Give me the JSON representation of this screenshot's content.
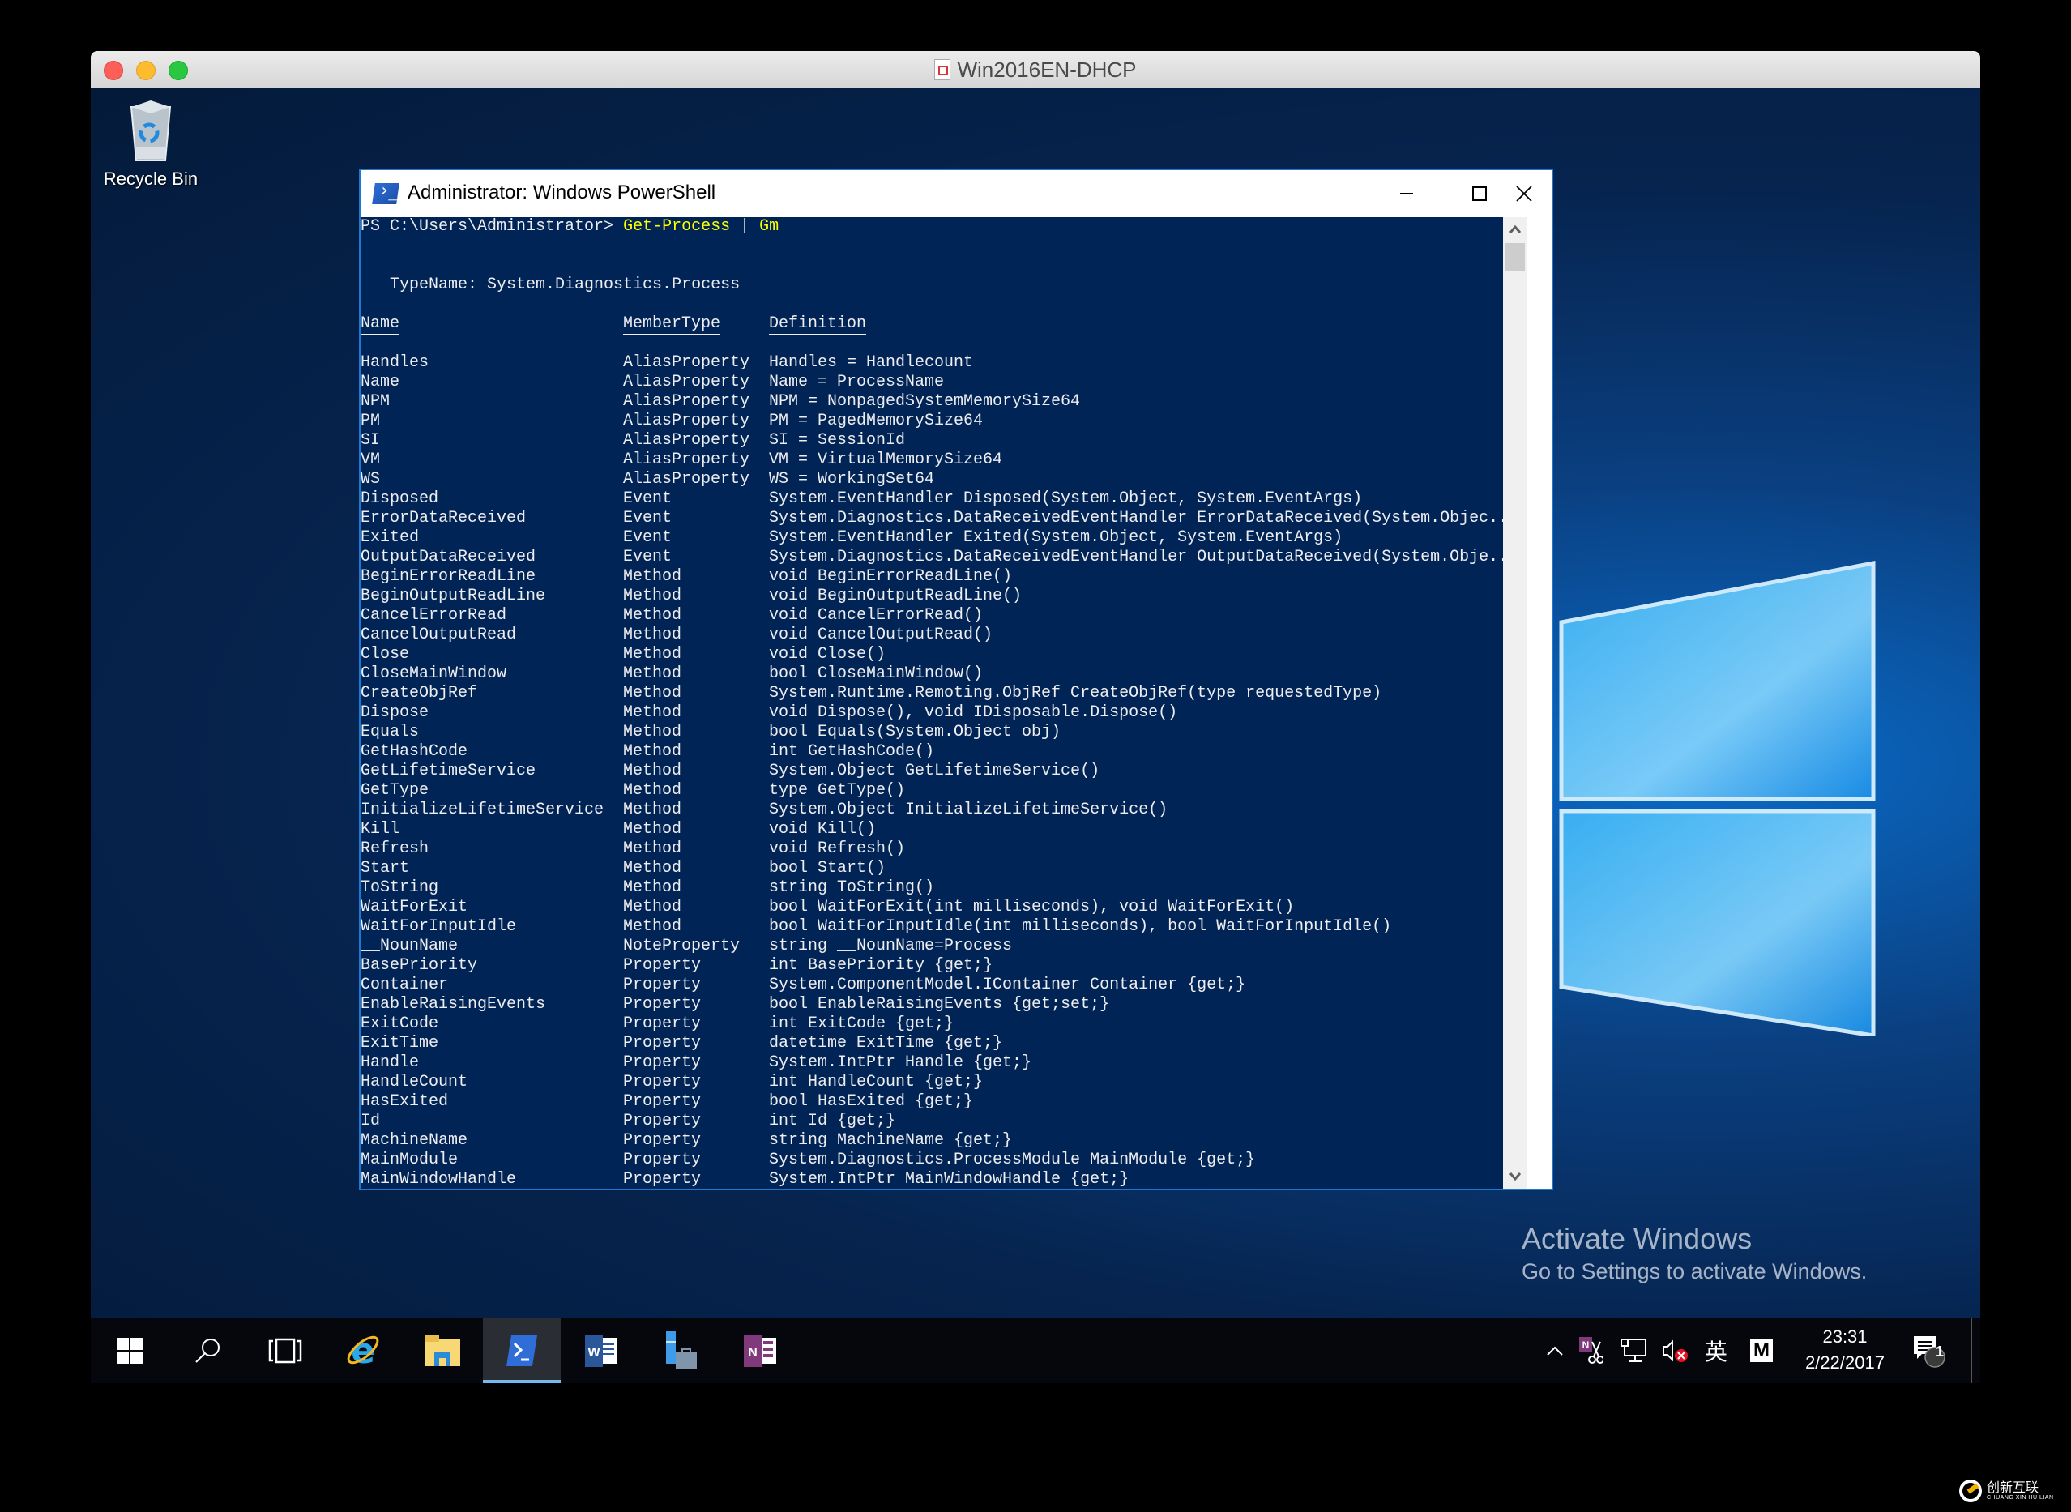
{
  "mac_window": {
    "title": "Win2016EN-DHCP"
  },
  "desktop": {
    "recycle_bin_label": "Recycle Bin",
    "activate_title": "Activate Windows",
    "activate_subtitle": "Go to Settings to activate Windows."
  },
  "powershell": {
    "title": "Administrator: Windows PowerShell",
    "prompt": "PS C:\\Users\\Administrator> ",
    "command_part1": "Get-Process",
    "pipe": " | ",
    "command_part2": "Gm",
    "typename_line": "   TypeName: System.Diagnostics.Process",
    "headers": {
      "name": "Name",
      "member_type": "MemberType",
      "definition": "Definition"
    },
    "rows": [
      {
        "name": "Handles",
        "type": "AliasProperty",
        "def": "Handles = Handlecount"
      },
      {
        "name": "Name",
        "type": "AliasProperty",
        "def": "Name = ProcessName"
      },
      {
        "name": "NPM",
        "type": "AliasProperty",
        "def": "NPM = NonpagedSystemMemorySize64"
      },
      {
        "name": "PM",
        "type": "AliasProperty",
        "def": "PM = PagedMemorySize64"
      },
      {
        "name": "SI",
        "type": "AliasProperty",
        "def": "SI = SessionId"
      },
      {
        "name": "VM",
        "type": "AliasProperty",
        "def": "VM = VirtualMemorySize64"
      },
      {
        "name": "WS",
        "type": "AliasProperty",
        "def": "WS = WorkingSet64"
      },
      {
        "name": "Disposed",
        "type": "Event",
        "def": "System.EventHandler Disposed(System.Object, System.EventArgs)"
      },
      {
        "name": "ErrorDataReceived",
        "type": "Event",
        "def": "System.Diagnostics.DataReceivedEventHandler ErrorDataReceived(System.Objec..."
      },
      {
        "name": "Exited",
        "type": "Event",
        "def": "System.EventHandler Exited(System.Object, System.EventArgs)"
      },
      {
        "name": "OutputDataReceived",
        "type": "Event",
        "def": "System.Diagnostics.DataReceivedEventHandler OutputDataReceived(System.Obje..."
      },
      {
        "name": "BeginErrorReadLine",
        "type": "Method",
        "def": "void BeginErrorReadLine()"
      },
      {
        "name": "BeginOutputReadLine",
        "type": "Method",
        "def": "void BeginOutputReadLine()"
      },
      {
        "name": "CancelErrorRead",
        "type": "Method",
        "def": "void CancelErrorRead()"
      },
      {
        "name": "CancelOutputRead",
        "type": "Method",
        "def": "void CancelOutputRead()"
      },
      {
        "name": "Close",
        "type": "Method",
        "def": "void Close()"
      },
      {
        "name": "CloseMainWindow",
        "type": "Method",
        "def": "bool CloseMainWindow()"
      },
      {
        "name": "CreateObjRef",
        "type": "Method",
        "def": "System.Runtime.Remoting.ObjRef CreateObjRef(type requestedType)"
      },
      {
        "name": "Dispose",
        "type": "Method",
        "def": "void Dispose(), void IDisposable.Dispose()"
      },
      {
        "name": "Equals",
        "type": "Method",
        "def": "bool Equals(System.Object obj)"
      },
      {
        "name": "GetHashCode",
        "type": "Method",
        "def": "int GetHashCode()"
      },
      {
        "name": "GetLifetimeService",
        "type": "Method",
        "def": "System.Object GetLifetimeService()"
      },
      {
        "name": "GetType",
        "type": "Method",
        "def": "type GetType()"
      },
      {
        "name": "InitializeLifetimeService",
        "type": "Method",
        "def": "System.Object InitializeLifetimeService()"
      },
      {
        "name": "Kill",
        "type": "Method",
        "def": "void Kill()"
      },
      {
        "name": "Refresh",
        "type": "Method",
        "def": "void Refresh()"
      },
      {
        "name": "Start",
        "type": "Method",
        "def": "bool Start()"
      },
      {
        "name": "ToString",
        "type": "Method",
        "def": "string ToString()"
      },
      {
        "name": "WaitForExit",
        "type": "Method",
        "def": "bool WaitForExit(int milliseconds), void WaitForExit()"
      },
      {
        "name": "WaitForInputIdle",
        "type": "Method",
        "def": "bool WaitForInputIdle(int milliseconds), bool WaitForInputIdle()"
      },
      {
        "name": "__NounName",
        "type": "NoteProperty",
        "def": "string __NounName=Process"
      },
      {
        "name": "BasePriority",
        "type": "Property",
        "def": "int BasePriority {get;}"
      },
      {
        "name": "Container",
        "type": "Property",
        "def": "System.ComponentModel.IContainer Container {get;}"
      },
      {
        "name": "EnableRaisingEvents",
        "type": "Property",
        "def": "bool EnableRaisingEvents {get;set;}"
      },
      {
        "name": "ExitCode",
        "type": "Property",
        "def": "int ExitCode {get;}"
      },
      {
        "name": "ExitTime",
        "type": "Property",
        "def": "datetime ExitTime {get;}"
      },
      {
        "name": "Handle",
        "type": "Property",
        "def": "System.IntPtr Handle {get;}"
      },
      {
        "name": "HandleCount",
        "type": "Property",
        "def": "int HandleCount {get;}"
      },
      {
        "name": "HasExited",
        "type": "Property",
        "def": "bool HasExited {get;}"
      },
      {
        "name": "Id",
        "type": "Property",
        "def": "int Id {get;}"
      },
      {
        "name": "MachineName",
        "type": "Property",
        "def": "string MachineName {get;}"
      },
      {
        "name": "MainModule",
        "type": "Property",
        "def": "System.Diagnostics.ProcessModule MainModule {get;}"
      },
      {
        "name": "MainWindowHandle",
        "type": "Property",
        "def": "System.IntPtr MainWindowHandle {get;}"
      }
    ],
    "colors": {
      "background": "#012456",
      "text": "#eeedf0",
      "command": "#ffff00"
    }
  },
  "taskbar": {
    "items": [
      {
        "name": "start",
        "icon": "windows-logo-icon"
      },
      {
        "name": "search",
        "icon": "search-icon"
      },
      {
        "name": "task-view",
        "icon": "task-view-icon"
      },
      {
        "name": "internet-explorer",
        "icon": "ie-icon"
      },
      {
        "name": "file-explorer",
        "icon": "folder-icon"
      },
      {
        "name": "powershell",
        "icon": "powershell-icon",
        "active": true
      },
      {
        "name": "word",
        "icon": "word-icon"
      },
      {
        "name": "server-manager",
        "icon": "server-manager-icon"
      },
      {
        "name": "onenote",
        "icon": "onenote-icon"
      }
    ],
    "tray": {
      "ime_label": "英",
      "ime_mode": "M",
      "time": "23:31",
      "date": "2/22/2017",
      "notification_count": "1"
    }
  },
  "watermark": {
    "cn": "创新互联",
    "en": "CHUANG XIN HU LIAN"
  }
}
